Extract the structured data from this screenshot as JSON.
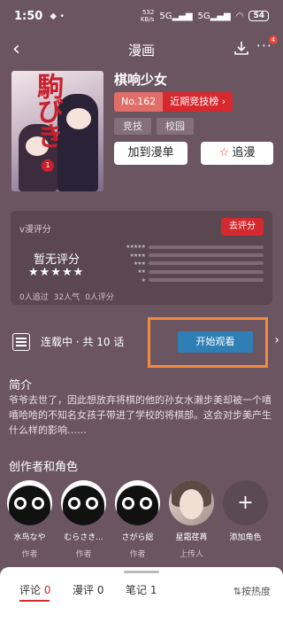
{
  "status_bar": {
    "time": "1:50",
    "speed_value": "532",
    "speed_unit": "KB/s",
    "signal1": "5G",
    "signal2": "5G",
    "battery": "54"
  },
  "header": {
    "title": "漫画",
    "more_badge": "4"
  },
  "manga": {
    "title": "棋响少女",
    "rank_no": "No.162",
    "rank_list": "近期竞技榜",
    "tags": [
      "竞技",
      "校园"
    ],
    "add_label": "加到漫单",
    "follow_label": "追漫",
    "cover_title": "駒びき",
    "cover_volume": "1"
  },
  "rating": {
    "label": "v漫评分",
    "rate_button": "去评分",
    "no_score": "暂无评分",
    "big_stars": "★★★★★",
    "bar_stars": [
      "★★★★★",
      "★★★★",
      "★★★",
      "★★",
      "★"
    ],
    "bar_values": [
      0,
      0,
      0,
      0,
      0
    ],
    "stats": [
      "0人追过",
      "32人气",
      "0人评分"
    ]
  },
  "series": {
    "status": "连载中 · 共 10 话",
    "start_button": "开始观看",
    "highlight_color": "#f28a40"
  },
  "intro": {
    "title": "简介",
    "text": "爷爷去世了，因此想放弃将棋的他的孙女水濑步美却被一个嘻嘻哈哈的不知名女孩子带进了学校的将棋部。这会对步美产生什么样的影响……"
  },
  "creators": {
    "title": "创作者和角色",
    "items": [
      {
        "name": "水鸟なや",
        "role": "作者"
      },
      {
        "name": "むらさき...",
        "role": "作者"
      },
      {
        "name": "さがら総",
        "role": "作者"
      },
      {
        "name": "星霜荏苒",
        "role": "上传人"
      },
      {
        "name": "添加角色",
        "role": ""
      }
    ]
  },
  "tabs": {
    "items": [
      {
        "label": "评论",
        "count": "0"
      },
      {
        "label": "漫评",
        "count": "0"
      },
      {
        "label": "笔记",
        "count": "1"
      }
    ],
    "sort_label": "按热度"
  },
  "colors": {
    "background": "#6b5560",
    "accent_red": "#d3292f",
    "start_blue": "#2f7fb5"
  }
}
